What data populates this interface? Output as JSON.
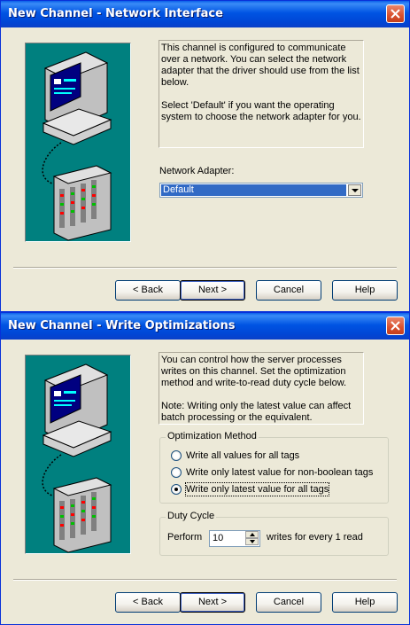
{
  "dialog1": {
    "title": "New Channel - Network Interface",
    "description_p1": "This channel is configured to communicate over a network.  You can select the network adapter that the driver should use from the list below.",
    "description_p2": "Select 'Default' if you want the operating system to choose the network adapter for you.",
    "adapter_label": "Network Adapter:",
    "adapter_value": "Default",
    "buttons": {
      "back": "Back",
      "next": "Next >",
      "cancel": "Cancel",
      "help": "Help"
    }
  },
  "dialog2": {
    "title": "New Channel - Write Optimizations",
    "description_p1": "You can control how the server processes writes on this channel.  Set the optimization method and write-to-read duty cycle below.",
    "description_p2": "Note:  Writing only the latest value can affect batch processing or the equivalent.",
    "optimization_group": {
      "title": "Optimization Method",
      "options": [
        {
          "label": "Write all values for all tags",
          "selected": false
        },
        {
          "label": "Write only latest value for non-boolean tags",
          "selected": false
        },
        {
          "label": "Write only latest value for all tags",
          "selected": true
        }
      ]
    },
    "duty_cycle_group": {
      "title": "Duty Cycle",
      "perform_label": "Perform",
      "perform_value": "10",
      "suffix": "writes for every 1 read"
    },
    "buttons": {
      "back": "Back",
      "next": "Next >",
      "cancel": "Cancel",
      "help": "Help"
    }
  },
  "colors": {
    "titlebar": "#0054E3",
    "dialog_bg": "#ECE9D8",
    "art_bg": "#00807F",
    "selection": "#316AC5",
    "close_button": "#D9502E"
  },
  "icons": [
    "close-icon",
    "computer-network-illustration",
    "dropdown-arrow-icon",
    "spin-up-icon",
    "spin-down-icon"
  ]
}
